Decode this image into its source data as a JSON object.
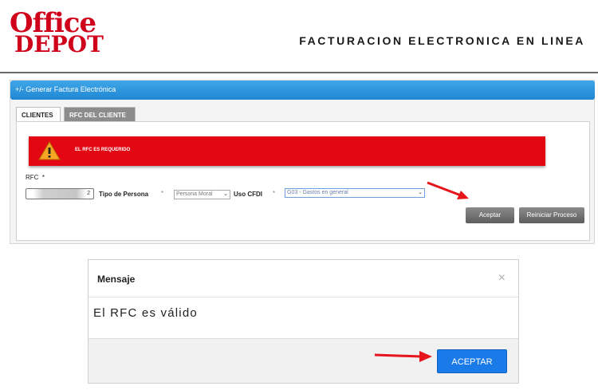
{
  "header": {
    "logo_line1": "Office",
    "logo_line2": "DEPOT",
    "title": "FACTURACION ELECTRONICA EN LINEA"
  },
  "panel": {
    "title": "+/- Generar Factura Electrónica",
    "tabs": [
      {
        "label": "CLIENTES",
        "active": true
      },
      {
        "label": "RFC DEL CLIENTE",
        "active": false
      }
    ],
    "alert": {
      "text": "EL RFC ES REQUERIDO",
      "color": "#e30613"
    },
    "form": {
      "rfc_label": "RFC",
      "required_mark": "*",
      "rfc_value": "2",
      "tipo_persona_label": "Tipo de Persona",
      "tipo_persona_value": "Persona Moral",
      "uso_cfdi_label": "Uso CFDI",
      "uso_cfdi_value": "G03 - Gastos en general"
    },
    "buttons": {
      "aceptar": "Aceptar",
      "reiniciar": "Reiniciar Proceso"
    }
  },
  "modal": {
    "title": "Mensaje",
    "close": "×",
    "message": "El RFC es válido",
    "ok_label": "ACEPTAR"
  },
  "colors": {
    "accent_blue": "#1a7be8",
    "brand_red": "#d0021b",
    "arrow_red": "#e8141b"
  }
}
